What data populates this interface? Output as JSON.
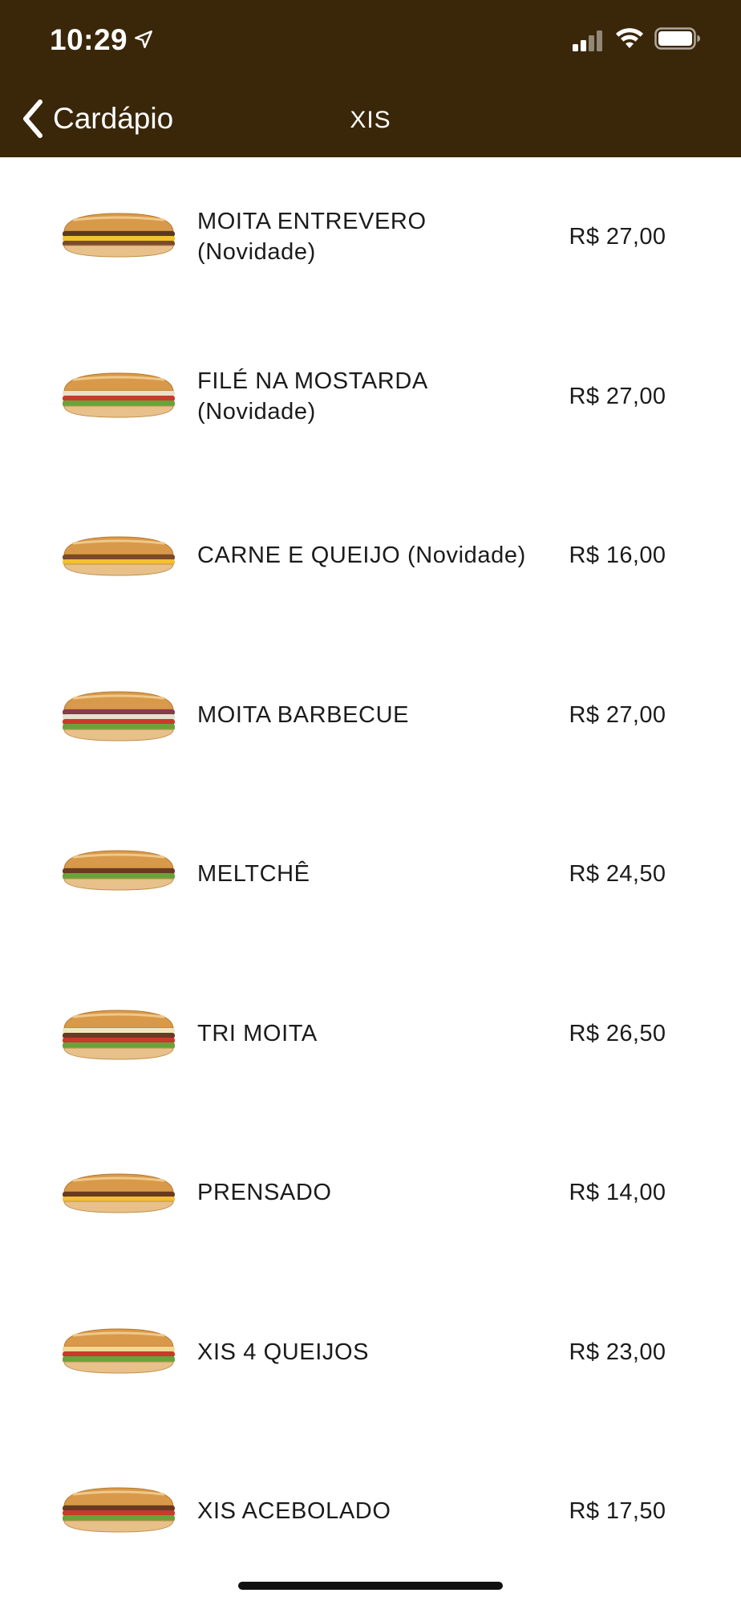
{
  "status_bar": {
    "time": "10:29",
    "icons": [
      "location-arrow-icon",
      "cellular-signal-icon",
      "wifi-icon",
      "battery-icon"
    ]
  },
  "nav": {
    "back_label": "Cardápio",
    "title": "XIS"
  },
  "colors": {
    "header_background": "#3a270a",
    "header_text": "#ffffff",
    "list_background": "#ffffff",
    "text": "#1b1b1b"
  },
  "menu": {
    "items": [
      {
        "name": "MOITA ENTREVERO (Novidade)",
        "price": "R$ 27,00",
        "image": "sandwich-entrevero-image"
      },
      {
        "name": "FILÉ NA MOSTARDA (Novidade)",
        "price": "R$ 27,00",
        "image": "sandwich-file-mostarda-image"
      },
      {
        "name": "CARNE E QUEIJO (Novidade)",
        "price": "R$ 16,00",
        "image": "sandwich-carne-queijo-image"
      },
      {
        "name": "MOITA BARBECUE",
        "price": "R$ 27,00",
        "image": "sandwich-barbecue-image"
      },
      {
        "name": "MELTCHÊ",
        "price": "R$ 24,50",
        "image": "sandwich-meltche-image"
      },
      {
        "name": "TRI MOITA",
        "price": "R$ 26,50",
        "image": "sandwich-tri-moita-image"
      },
      {
        "name": "PRENSADO",
        "price": "R$ 14,00",
        "image": "sandwich-prensado-image"
      },
      {
        "name": "XIS 4 QUEIJOS",
        "price": "R$ 23,00",
        "image": "sandwich-4-queijos-image"
      },
      {
        "name": "XIS ACEBOLADO",
        "price": "R$ 17,50",
        "image": "sandwich-acebolado-image"
      }
    ]
  }
}
